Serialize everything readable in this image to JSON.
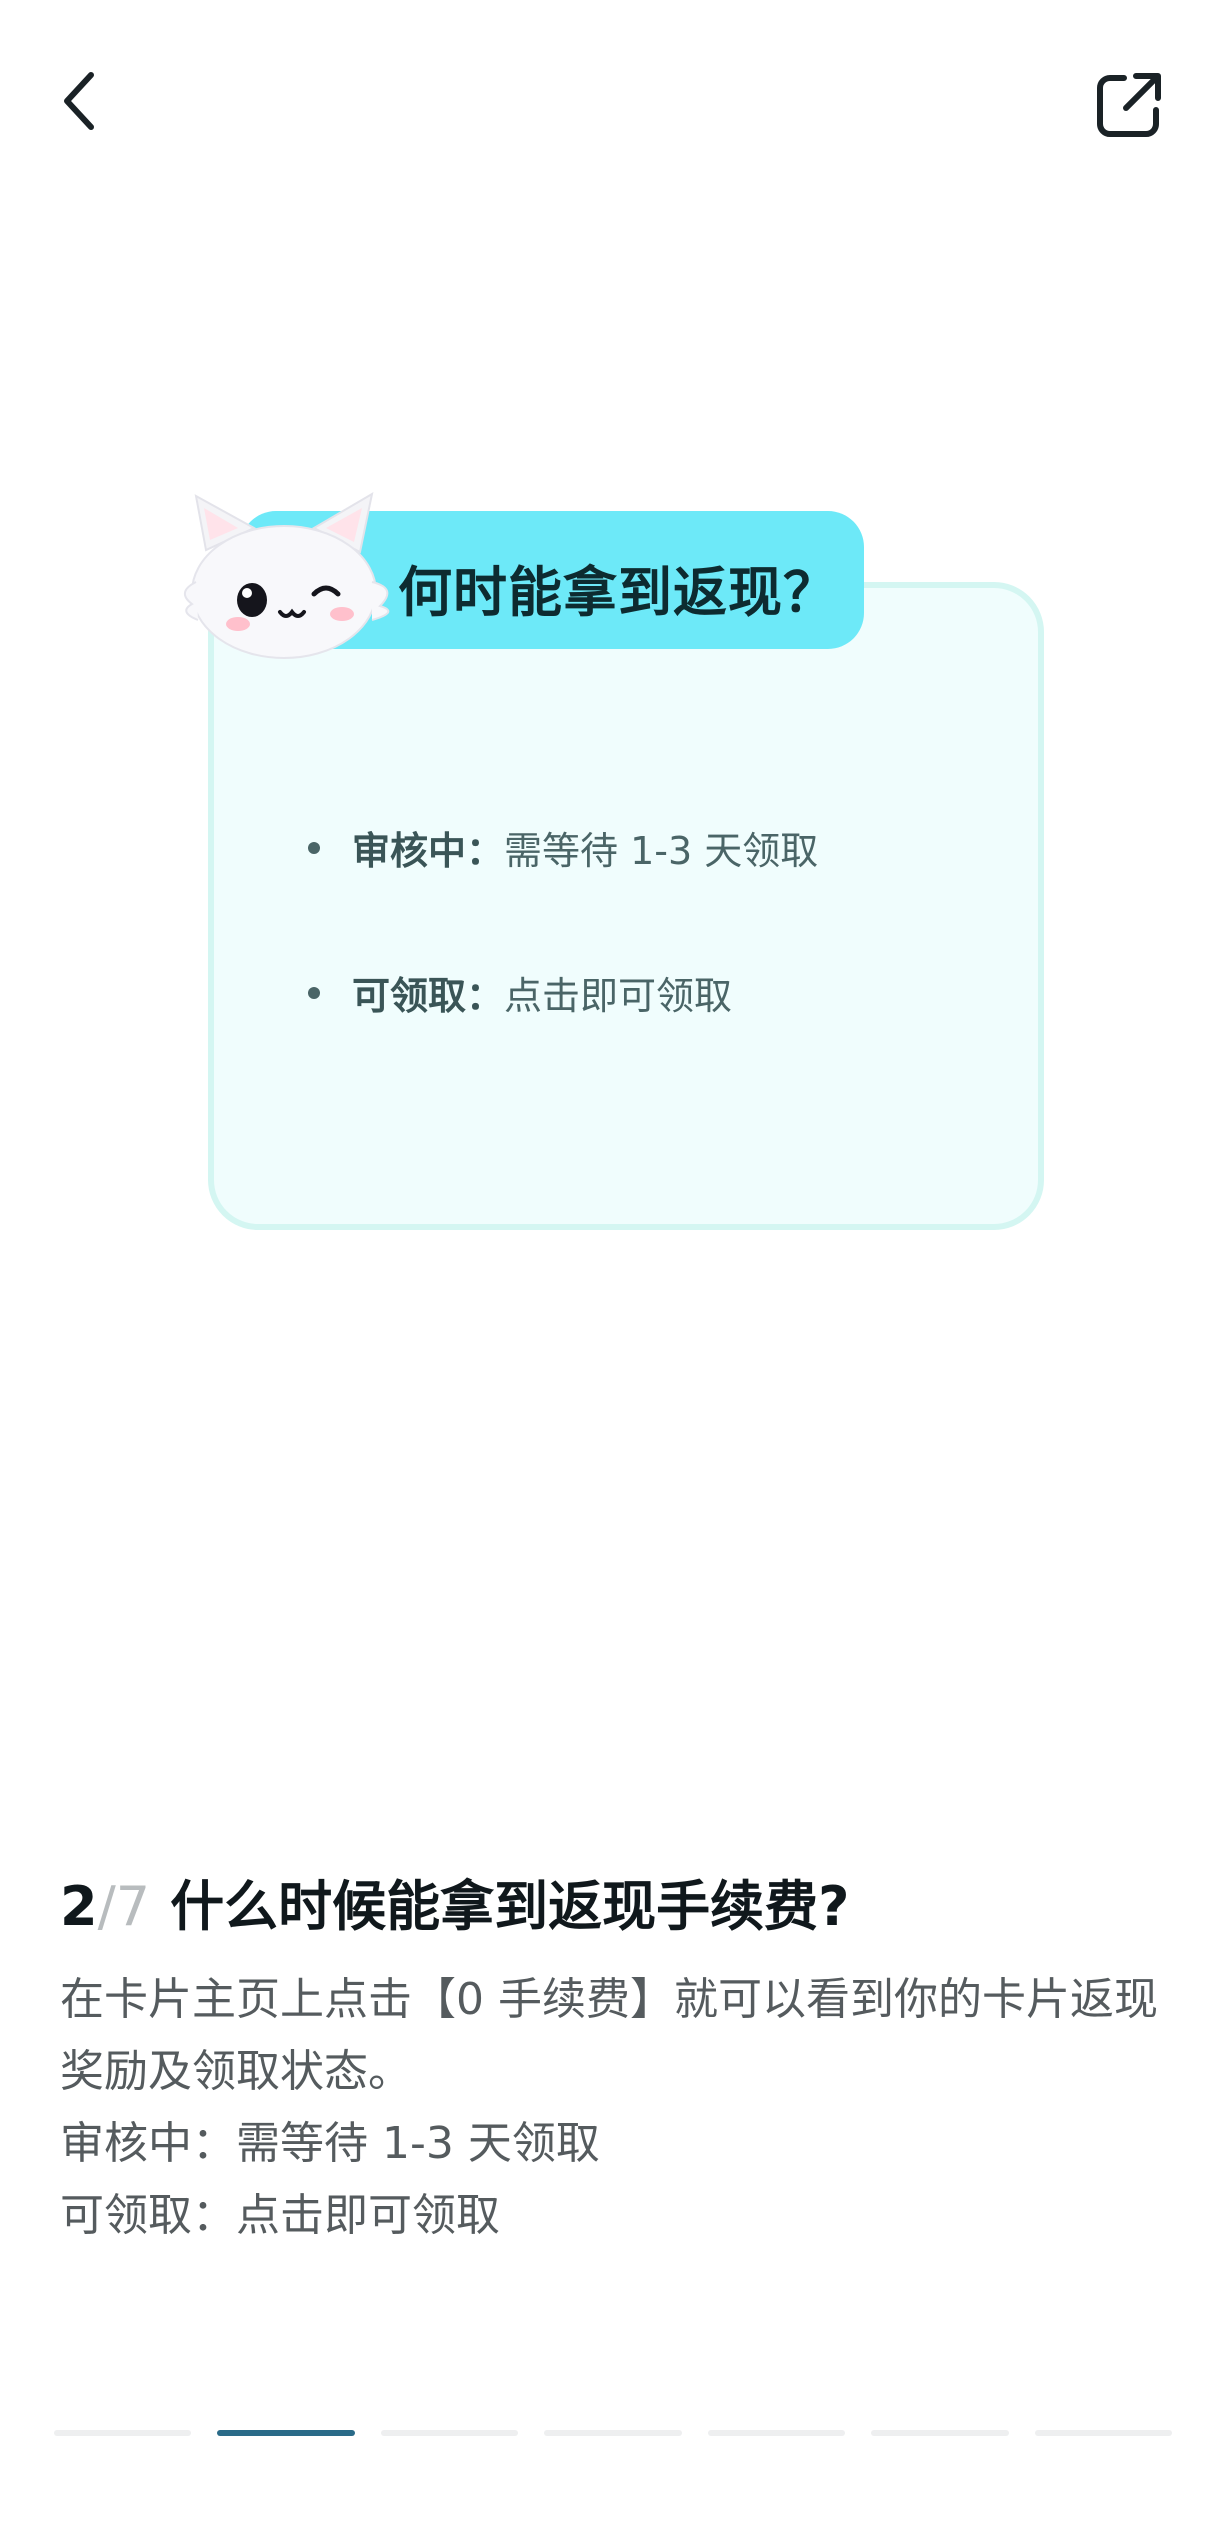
{
  "nav": {
    "back_icon": "chevron-left-icon",
    "share_icon": "share-external-icon"
  },
  "card": {
    "title": "何时能拿到返现？",
    "items": [
      {
        "label": "审核中：",
        "text": "需等待 1-3 天领取"
      },
      {
        "label": "可领取：",
        "text": "点击即可领取"
      }
    ],
    "mascot": "cat-mascot-icon"
  },
  "step": {
    "current": "2",
    "total": "/7",
    "question": "什么时候能拿到返现手续费?"
  },
  "description": {
    "lines": [
      "在卡片主页上点击【0 手续费】就可以看到你的卡片返现奖励及领取状态。",
      "审核中：需等待 1-3 天领取",
      "可领取：点击即可领取"
    ]
  },
  "progress": {
    "total_steps": 7,
    "active_index": 1
  },
  "colors": {
    "accent": "#2a6b88",
    "pill": "#6de9f8",
    "card_bg": "#f0fdfd",
    "card_border": "#d4f6f2"
  }
}
